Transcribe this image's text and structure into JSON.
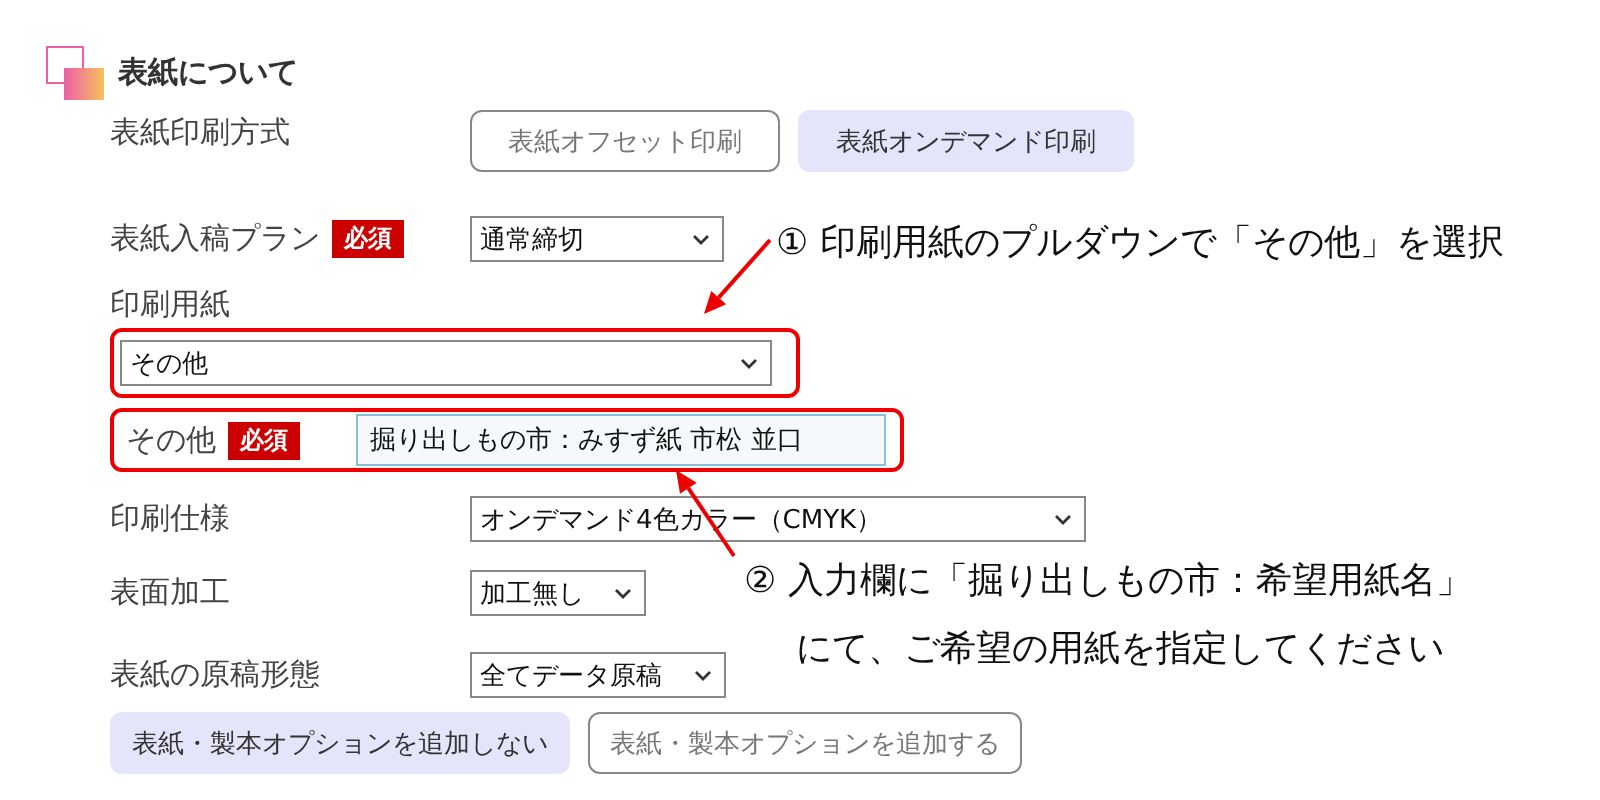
{
  "section": {
    "title": "表紙について"
  },
  "fields": [
    {
      "kind": "toggle",
      "label": "表紙印刷方式",
      "highlighted": false,
      "options": [
        {
          "label": "表紙オフセット印刷",
          "selected": false
        },
        {
          "label": "表紙オンデマンド印刷",
          "selected": true
        }
      ]
    },
    {
      "kind": "select",
      "label": "表紙入稿プラン",
      "badge": "必須",
      "value": "通常締切",
      "highlighted": false
    },
    {
      "kind": "stacked_select",
      "label": "印刷用紙",
      "value": "その他",
      "highlighted": true
    },
    {
      "kind": "text_input",
      "label": "その他",
      "badge": "必須",
      "value": "掘り出しもの市：みすず紙 市松 並口",
      "highlighted": true
    },
    {
      "kind": "select",
      "label": "印刷仕様",
      "value": "オンデマンド4色カラー（CMYK）",
      "highlighted": false
    },
    {
      "kind": "select",
      "label": "表面加工",
      "value": "加工無し",
      "highlighted": false
    },
    {
      "kind": "select",
      "label": "表紙の原稿形態",
      "value": "全てデータ原稿",
      "highlighted": false
    }
  ],
  "option_buttons": [
    {
      "label": "表紙・製本オプションを追加しない",
      "selected": true
    },
    {
      "label": "表紙・製本オプションを追加する",
      "selected": false
    }
  ],
  "annotations": [
    {
      "lines": [
        "① 印刷用紙のプルダウンで「その他」を選択"
      ]
    },
    {
      "lines": [
        "② 入力欄に「掘り出しもの市：希望用紙名」",
        "にて、ご希望の用紙を指定してください"
      ]
    }
  ]
}
